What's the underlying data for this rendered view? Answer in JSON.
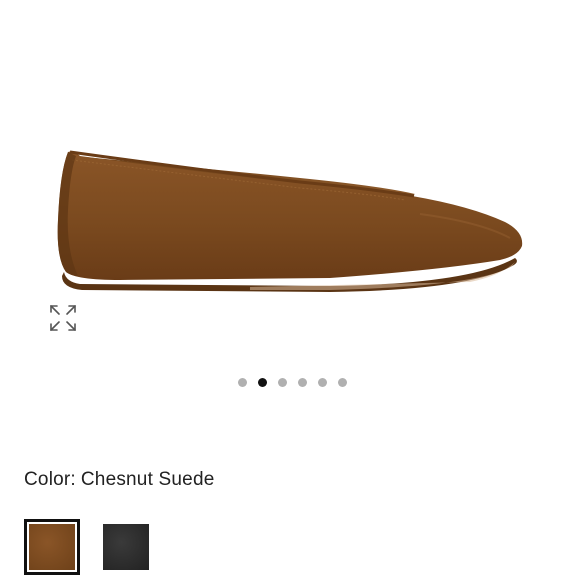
{
  "product": {
    "color_label": "Color:",
    "color_value": "Chesnut Suede"
  },
  "gallery": {
    "image_count": 6,
    "active_index": 1
  },
  "icons": {
    "expand": "expand-arrows-icon"
  },
  "colors": {
    "shoe_main": "#7b4a1f",
    "shoe_shadow": "#5e3614",
    "sole": "#6b3f1b",
    "dot_inactive": "#b0b0b0",
    "dot_active": "#111111"
  },
  "swatches": [
    {
      "name": "Chesnut Suede",
      "color": "#7a4a1e",
      "selected": true
    },
    {
      "name": "Black",
      "color": "#2c2c2c",
      "selected": false
    }
  ]
}
